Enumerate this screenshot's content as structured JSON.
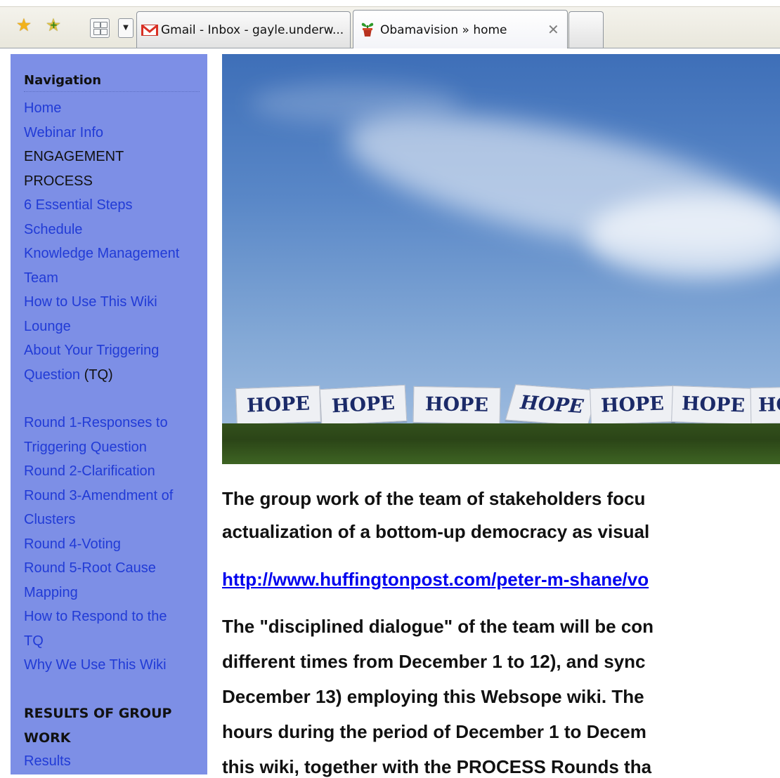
{
  "browser": {
    "tabs": [
      {
        "label": "Gmail - Inbox - gayle.underw..."
      },
      {
        "label": "Obamavision » home"
      }
    ]
  },
  "sidebar": {
    "heading": "Navigation",
    "items": [
      {
        "label": "Home",
        "link": true
      },
      {
        "label": "Webinar Info",
        "link": true
      },
      {
        "label": "ENGAGEMENT",
        "link": false
      },
      {
        "label": "PROCESS",
        "link": false
      },
      {
        "label": "6 Essential Steps",
        "link": true
      },
      {
        "label": "Schedule",
        "link": true
      },
      {
        "label": "Knowledge Management",
        "link": true
      },
      {
        "label": "Team",
        "link": true
      },
      {
        "label": "How to Use This Wiki",
        "link": true
      },
      {
        "label": "Lounge",
        "link": true
      },
      {
        "label": "About Your Triggering",
        "link": true
      },
      {
        "label": "Question",
        "link": true,
        "suffix": " (TQ)"
      }
    ],
    "rounds": [
      {
        "label": "Round 1-Responses to"
      },
      {
        "label": "Triggering Question"
      },
      {
        "label": "Round 2-Clarification"
      },
      {
        "label": "Round 3-Amendment of"
      },
      {
        "label": "Clusters"
      },
      {
        "label": "Round 4-Voting"
      },
      {
        "label": "Round 5-Root Cause"
      },
      {
        "label": "Mapping"
      },
      {
        "label": "How to Respond to the"
      },
      {
        "label": "TQ"
      },
      {
        "label": "Why We Use This Wiki"
      }
    ],
    "results_heading_line1": "RESULTS OF GROUP",
    "results_heading_line2": "WORK",
    "results_link": "Results"
  },
  "hero": {
    "signs": [
      "HOPE",
      "HOPE",
      "HOPE",
      "HOPE",
      "HOPE",
      "HOPE",
      "HOPE"
    ]
  },
  "content": {
    "para1_line1": "The group work of the team of stakeholders focu",
    "para1_line2": "actualization of a bottom-up democracy as visual",
    "link_text": "http://www.huffingtonpost.com/peter-m-shane/vo",
    "para2_line1": "The \"disciplined dialogue\" of the team will be con",
    "para2_line2": "different times from December 1 to 12), and sync",
    "para2_line3": "December 13) employing this Websope wiki. The",
    "para2_line4": "hours during the period of December 1 to Decem",
    "para2_line5": "this wiki, together with the PROCESS Rounds tha"
  }
}
